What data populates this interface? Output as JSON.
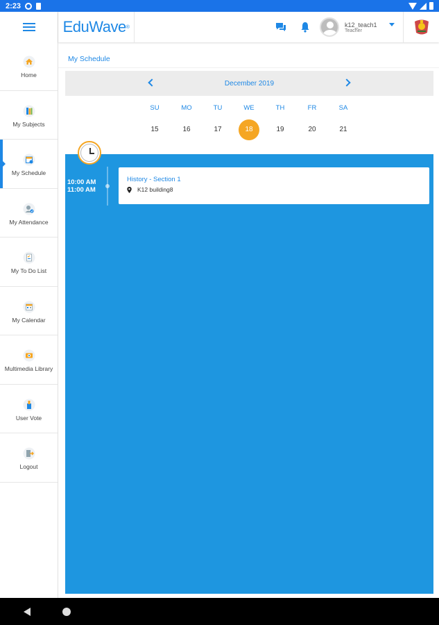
{
  "status_bar": {
    "time": "2:23"
  },
  "app": {
    "logo_edu": "Edu",
    "logo_wave": "Wave",
    "logo_mark": "®"
  },
  "user": {
    "name": "k12_teach1",
    "role": "Teacher"
  },
  "sidebar": {
    "items": [
      {
        "label": "Home",
        "icon": "home-icon"
      },
      {
        "label": "My Subjects",
        "icon": "subjects-icon"
      },
      {
        "label": "My Schedule",
        "icon": "schedule-icon",
        "active": true
      },
      {
        "label": "My Attendance",
        "icon": "attendance-icon"
      },
      {
        "label": "My To Do List",
        "icon": "todo-icon"
      },
      {
        "label": "My Calendar",
        "icon": "calendar-icon"
      },
      {
        "label": "Multimedia Library",
        "icon": "multimedia-icon"
      },
      {
        "label": "User Vote",
        "icon": "vote-icon"
      },
      {
        "label": "Logout",
        "icon": "logout-icon"
      }
    ]
  },
  "page": {
    "title": "My Schedule"
  },
  "calendar": {
    "month": "December 2019",
    "weekdays": [
      "SU",
      "MO",
      "TU",
      "WE",
      "TH",
      "FR",
      "SA"
    ],
    "days": [
      "15",
      "16",
      "17",
      "18",
      "19",
      "20",
      "21"
    ],
    "selected_day": "18"
  },
  "events": [
    {
      "start": "10:00 AM",
      "end": "11:00 AM",
      "title": "History - Section 1",
      "location": "K12 building8"
    }
  ],
  "colors": {
    "accent": "#1e88e5",
    "schedule_bg": "#1e96e0",
    "today": "#f5a623"
  }
}
